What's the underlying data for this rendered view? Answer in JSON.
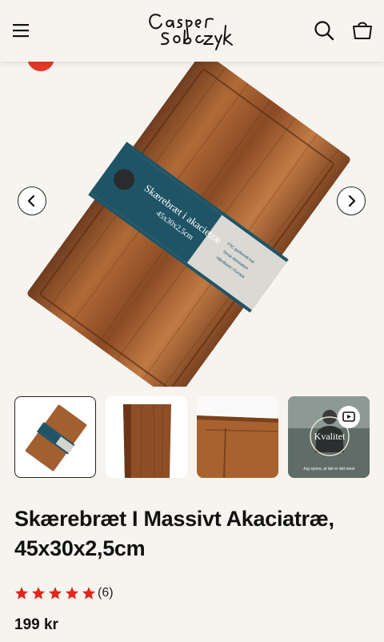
{
  "header": {
    "menu_icon": "hamburger-menu-icon",
    "logo_text": "Casper Sobczyk",
    "search_icon": "search-icon",
    "cart_icon": "shopping-bag-icon"
  },
  "gallery": {
    "packaging_title": "Skærebræt i akacietræ",
    "packaging_size": "45x30x2,5cm",
    "packaging_bullets": [
      "FSC godkendt træ",
      "Smuk dekoration",
      "Håndlavet i Europa"
    ],
    "prev_icon": "chevron-left-icon",
    "next_icon": "chevron-right-icon"
  },
  "thumbnails": [
    {
      "label": "board-packaged",
      "active": true
    },
    {
      "label": "board-edge-closeup",
      "active": false
    },
    {
      "label": "board-corner-closeup",
      "active": false
    },
    {
      "label": "video",
      "active": false,
      "video_badge_text": "Kvalitet",
      "caption": "Jeg synes, at det er det mest"
    }
  ],
  "product": {
    "title": "Skærebræt I Massivt Akaciatræ, 45x30x2,5cm",
    "rating": {
      "stars": 5,
      "count_label": "(6)"
    },
    "price": "199 kr"
  },
  "colors": {
    "background": "#f7f4f0",
    "star": "#e1251b",
    "sale_badge": "#e43a2a",
    "wood": "#9a5a2e",
    "band": "#1f5466"
  }
}
